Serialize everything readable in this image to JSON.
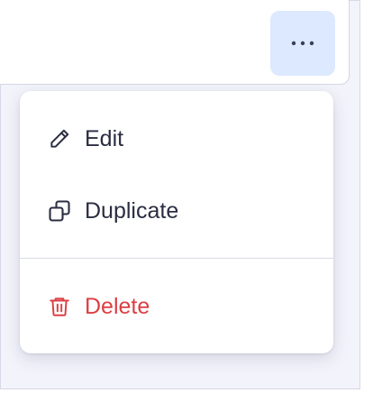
{
  "header": {
    "more_button_icon": "more-horizontal-icon"
  },
  "menu": {
    "items": [
      {
        "label": "Edit",
        "icon": "pencil-icon"
      },
      {
        "label": "Duplicate",
        "icon": "copy-icon"
      },
      {
        "label": "Delete",
        "icon": "trash-icon"
      }
    ]
  },
  "colors": {
    "accent_bg": "#dde9ff",
    "text": "#2b2d42",
    "danger": "#dc3f44",
    "frame_bg": "#f3f3fb"
  }
}
